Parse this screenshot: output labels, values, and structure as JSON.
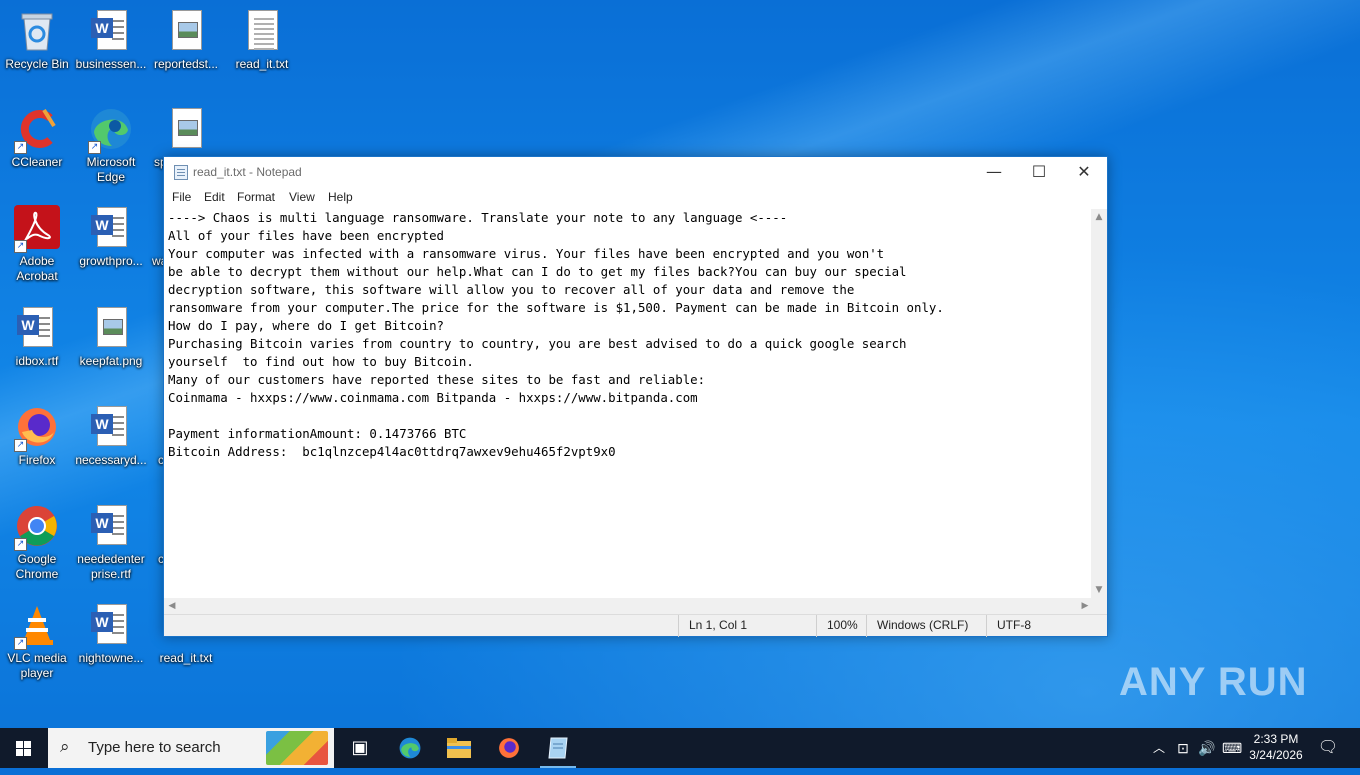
{
  "desktop": {
    "icons": [
      {
        "label": "Recycle Bin",
        "icon": "recycle-bin-icon"
      },
      {
        "label": "businessen...",
        "icon": "word-doc-icon"
      },
      {
        "label": "reportedst...",
        "icon": "image-file-icon"
      },
      {
        "label": "read_it.txt",
        "icon": "text-file-icon"
      },
      {
        "label": "CCleaner",
        "icon": "ccleaner-icon"
      },
      {
        "label": "Microsoft Edge",
        "icon": "edge-icon"
      },
      {
        "label": "sp",
        "icon": "image-file-icon"
      },
      {
        "label": "Adobe Acrobat",
        "icon": "acrobat-icon"
      },
      {
        "label": "growthpro...",
        "icon": "word-doc-icon"
      },
      {
        "label": "wa",
        "icon": "file-icon"
      },
      {
        "label": "idbox.rtf",
        "icon": "word-doc-icon"
      },
      {
        "label": "keepfat.png",
        "icon": "image-file-icon"
      },
      {
        "label": "Firefox",
        "icon": "firefox-icon"
      },
      {
        "label": "necessaryd...",
        "icon": "word-doc-icon"
      },
      {
        "label": "c",
        "icon": "file-icon"
      },
      {
        "label": "Google Chrome",
        "icon": "chrome-icon"
      },
      {
        "label": "neededenterprise.rtf",
        "icon": "word-doc-icon"
      },
      {
        "label": "c",
        "icon": "file-icon"
      },
      {
        "label": "VLC media player",
        "icon": "vlc-icon"
      },
      {
        "label": "nightowne...",
        "icon": "word-doc-icon"
      },
      {
        "label": "read_it.txt",
        "icon": "text-file-icon"
      }
    ],
    "watermark": "ANY RUN"
  },
  "notepad": {
    "title": "read_it.txt - Notepad",
    "menu": [
      "File",
      "Edit",
      "Format",
      "View",
      "Help"
    ],
    "content": "----> Chaos is multi language ransomware. Translate your note to any language <----\nAll of your files have been encrypted\nYour computer was infected with a ransomware virus. Your files have been encrypted and you won't\nbe able to decrypt them without our help.What can I do to get my files back?You can buy our special\ndecryption software, this software will allow you to recover all of your data and remove the\nransomware from your computer.The price for the software is $1,500. Payment can be made in Bitcoin only.\nHow do I pay, where do I get Bitcoin?\nPurchasing Bitcoin varies from country to country, you are best advised to do a quick google search\nyourself  to find out how to buy Bitcoin.\nMany of our customers have reported these sites to be fast and reliable:\nCoinmama - hxxps://www.coinmama.com Bitpanda - hxxps://www.bitpanda.com\n\nPayment informationAmount: 0.1473766 BTC\nBitcoin Address:  bc1qlnzcep4l4ac0ttdrq7awxev9ehu465f2vpt9x0",
    "status": {
      "position": "Ln 1, Col 1",
      "zoom": "100%",
      "line_ending": "Windows (CRLF)",
      "encoding": "UTF-8"
    }
  },
  "taskbar": {
    "search_placeholder": "Type here to search",
    "time": "2:33 PM",
    "date": "3/24/2026"
  }
}
